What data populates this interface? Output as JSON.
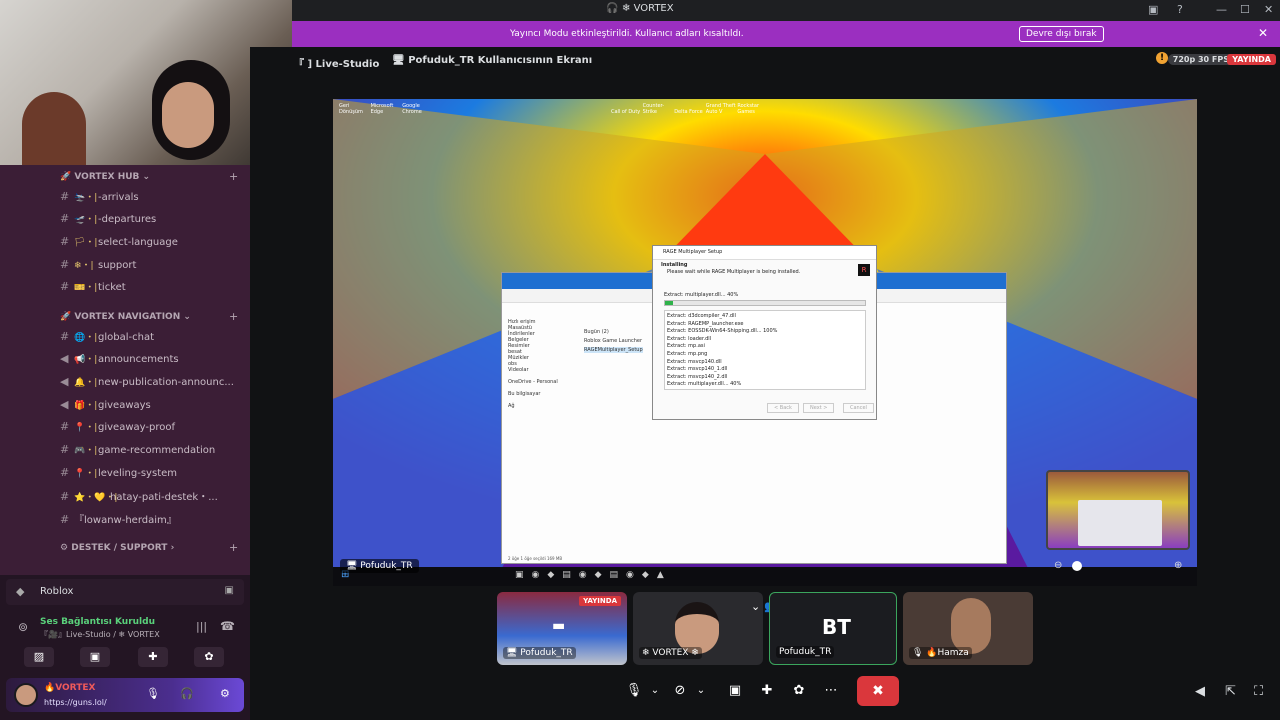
{
  "window": {
    "title": "VORTEX",
    "app_icon": "discord-icon"
  },
  "banner": {
    "text": "Yayıncı Modu etkinleştirildi. Kullanıcı adları kısaltıldı.",
    "button": "Devre dışı bırak",
    "close": "✕"
  },
  "sidebar": {
    "categories": [
      {
        "name": "VORTEX HUB",
        "emoji": "🚀"
      },
      {
        "name": "VORTEX NAVIGATION",
        "emoji": "🚀"
      },
      {
        "name": "DESTEK / SUPPORT",
        "emoji": "⚙"
      }
    ],
    "channels": [
      {
        "label": "-arrivals",
        "emoji": "🛬・|"
      },
      {
        "label": "-departures",
        "emoji": "🛫・|"
      },
      {
        "label": "select-language",
        "emoji": "🏳・|"
      },
      {
        "label": "support",
        "emoji": "❄・|"
      },
      {
        "label": "ticket",
        "emoji": "🎫・|"
      },
      {
        "label": "global-chat",
        "emoji": "🌐・|"
      },
      {
        "label": "announcements",
        "emoji": "📢・|"
      },
      {
        "label": "new-publication-announc...",
        "emoji": "🔔・|"
      },
      {
        "label": "giveaways",
        "emoji": "🎁・|"
      },
      {
        "label": "giveaway-proof",
        "emoji": "📍・|"
      },
      {
        "label": "game-recommendation",
        "emoji": "🎮・|"
      },
      {
        "label": "leveling-system",
        "emoji": "📍・|"
      },
      {
        "label": "hatay-pati-destek・...",
        "emoji": "⭐・💛・|"
      },
      {
        "label": "『lowanw-herdaim』",
        "emoji": ""
      }
    ]
  },
  "panel": {
    "activity": "Roblox",
    "voice_status": "Ses Bağlantısı Kuruldu",
    "voice_channel": "『🎥』Live-Studio / ❄ VORTEX",
    "user_name": "🔥VORTEX",
    "user_url": "https://guns.lol/"
  },
  "stage": {
    "channel": "『 ] Live-Studio",
    "screen_title": "Pofuduk_TR Kullanıcısının Ekranı",
    "quality": "720p 30 FPS",
    "live": "YAYINDA"
  },
  "installer": {
    "title": "RAGE Multiplayer Setup",
    "heading": "Installing",
    "subheading": "Please wait while RAGE Multiplayer is being installed.",
    "current": "Extract: multiplayer.dll... 40%",
    "progress": 0.04,
    "log": [
      "Extract: d3dcompiler_47.dll",
      "Extract: RAGEMP_launcher.exe",
      "Extract: EOSSDK-Win64-Shipping.dll... 100%",
      "Extract: loader.dll",
      "Extract: mp.asi",
      "Extract: mp.png",
      "Extract: msvcp140.dll",
      "Extract: msvcp140_1.dll",
      "Extract: msvcp140_2.dll",
      "Extract: multiplayer.dll... 40%"
    ],
    "buttons": [
      "< Back",
      "Next >",
      "Cancel"
    ]
  },
  "explorer": {
    "nav": [
      "Hızlı erişim",
      "Masaüstü",
      "İndirilenler",
      "Belgeler",
      "Resimler",
      "besat",
      "Müzikler",
      "obs",
      "Videolar",
      "OneDrive - Personal",
      "Bu bilgisayar",
      "Ağ"
    ],
    "group": "Bugün (2)",
    "files": [
      "Roblox Game Launcher",
      "RAGEMultiplayer_Setup"
    ],
    "status": "2 öğe   1 öğe seçildi  169 MB"
  },
  "desktop_icons": [
    "Geri Dönüşüm",
    "Microsoft Edge",
    "Google Chrome",
    "Call of Duty",
    "Counter-Strike",
    "Delta Force",
    "Grand Theft Auto V",
    "Rockstar Games"
  ],
  "taskbar_label": "Pofuduk_TR",
  "participants": [
    {
      "name": "Pofuduk_TR",
      "live": "YAYINDA",
      "kind": "stream"
    },
    {
      "name": "❄ VORTEX ❄",
      "kind": "camera"
    },
    {
      "name": "Pofuduk_TR",
      "kind": "avatar",
      "initials": "BT"
    },
    {
      "name": "🔥Hamza",
      "kind": "camera"
    }
  ],
  "controls": [
    "microphone-icon",
    "camera-off-icon",
    "screen-share-icon",
    "activity-icon",
    "soundboard-icon",
    "more-icon",
    "end-call-icon"
  ],
  "colors": {
    "banner": "#9b2fc0",
    "live": "#da373c",
    "sidebar": "#3b1e36",
    "accent": "#5ad17b"
  }
}
